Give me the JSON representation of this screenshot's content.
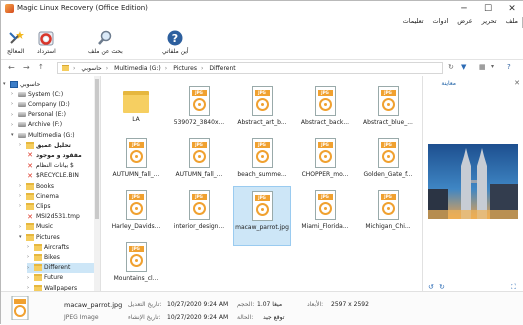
{
  "window": {
    "title": "Magic Linux Recovery (Office Edition)",
    "minimize": "─",
    "maximize": "☐",
    "close": "✕"
  },
  "menu": [
    "ملف",
    "تحرير",
    "عرض",
    "ادوات",
    "تعليمات"
  ],
  "ribbon": {
    "wizard": "المعالج",
    "recover": "استرداد",
    "search": "بحث عن ملف",
    "help": "أين ملفاتي"
  },
  "address": {
    "segments": [
      "حاسوبي",
      "Multimedia (G:)",
      "Pictures",
      "Different"
    ],
    "sep": "›"
  },
  "tree": [
    {
      "label": "حاسوبي",
      "type": "pc",
      "level": 0,
      "expanded": true
    },
    {
      "label": "System (C:)",
      "type": "drive",
      "level": 1
    },
    {
      "label": "Company (D:)",
      "type": "drive",
      "level": 1
    },
    {
      "label": "Personal (E:)",
      "type": "drive",
      "level": 1
    },
    {
      "label": "Archive (F:)",
      "type": "drive",
      "level": 1
    },
    {
      "label": "Multimedia (G:)",
      "type": "drive",
      "level": 1,
      "expanded": true
    },
    {
      "label": "تحليل عميق",
      "type": "folder",
      "level": 2,
      "bold": true
    },
    {
      "label": "مفقود و موجود",
      "type": "x",
      "level": 2,
      "bold": true
    },
    {
      "label": "بيانات النظام $",
      "type": "x",
      "level": 2
    },
    {
      "label": "$RECYCLE.BIN",
      "type": "x",
      "level": 2
    },
    {
      "label": "Books",
      "type": "folder",
      "level": 2
    },
    {
      "label": "Cinema",
      "type": "folder",
      "level": 2
    },
    {
      "label": "Clips",
      "type": "folder",
      "level": 2
    },
    {
      "label": "MSI2d531.tmp",
      "type": "x",
      "level": 2
    },
    {
      "label": "Music",
      "type": "folder",
      "level": 2
    },
    {
      "label": "Pictures",
      "type": "folder",
      "level": 2,
      "expanded": true
    },
    {
      "label": "Aircrafts",
      "type": "folder",
      "level": 3
    },
    {
      "label": "Bikes",
      "type": "folder",
      "level": 3
    },
    {
      "label": "Different",
      "type": "folder",
      "level": 3,
      "selected": true
    },
    {
      "label": "Future",
      "type": "folder",
      "level": 3
    },
    {
      "label": "Wallpapers",
      "type": "folder",
      "level": 3
    }
  ],
  "files": [
    {
      "name": "LA",
      "type": "folder"
    },
    {
      "name": "539072_3840x...",
      "type": "jpg"
    },
    {
      "name": "Abstract_art_b...",
      "type": "jpg"
    },
    {
      "name": "Abstract_back...",
      "type": "jpg"
    },
    {
      "name": "Abstract_blue_...",
      "type": "jpg"
    },
    {
      "name": "AUTUMN_fall_...",
      "type": "jpg"
    },
    {
      "name": "AUTUMN_fall_...",
      "type": "jpg"
    },
    {
      "name": "beach_summe...",
      "type": "jpg"
    },
    {
      "name": "CHOPPER_mo...",
      "type": "jpg"
    },
    {
      "name": "Golden_Gate_f...",
      "type": "jpg"
    },
    {
      "name": "Harley_Davids...",
      "type": "jpg"
    },
    {
      "name": "interior_design...",
      "type": "jpg"
    },
    {
      "name": "macaw_parrot.jpg",
      "type": "jpg",
      "selected": true
    },
    {
      "name": "Miami_Florida...",
      "type": "jpg"
    },
    {
      "name": "Michigan_Chi...",
      "type": "jpg"
    },
    {
      "name": "Mountains_cl...",
      "type": "jpg"
    }
  ],
  "preview": {
    "title": "معاينة"
  },
  "status": {
    "filename": "macaw_parrot.jpg",
    "filetype": "JPEG Image",
    "modified_label": "تاريخ التعديل:",
    "modified": "10/27/2020 9:24 AM",
    "created_label": "تاريخ الإنشاء:",
    "created": "10/27/2020 9:24 AM",
    "size_label": "الحجم:",
    "size": "1.07 ميغا",
    "status_label": "الحالة:",
    "status": "توقع جيد",
    "dims_label": "الأبعاد:",
    "dims": "2597 x 2592"
  },
  "colors": {
    "accent": "#1b5fa5",
    "selection": "#cde6f7",
    "jpg_band": "#f0a130",
    "folder": "#f5cd5e"
  },
  "icons": {
    "wizard": "wand-icon",
    "recover": "lifebuoy-icon",
    "search": "magnifier-icon",
    "help": "question-icon"
  }
}
